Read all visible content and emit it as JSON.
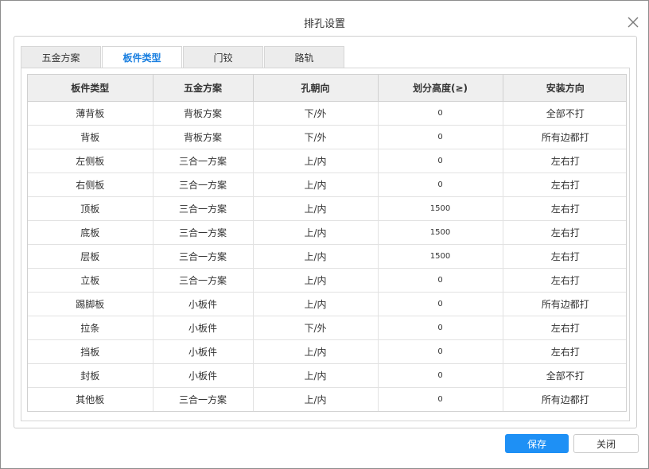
{
  "dialog": {
    "title": "排孔设置",
    "close_icon": "close-icon"
  },
  "tabs": [
    {
      "label": "五金方案",
      "active": false
    },
    {
      "label": "板件类型",
      "active": true
    },
    {
      "label": "门铰",
      "active": false
    },
    {
      "label": "路轨",
      "active": false
    }
  ],
  "table": {
    "headers": [
      "板件类型",
      "五金方案",
      "孔朝向",
      "划分高度(≥)",
      "安装方向"
    ],
    "rows": [
      [
        "薄背板",
        "背板方案",
        "下/外",
        "0",
        "全部不打"
      ],
      [
        "背板",
        "背板方案",
        "下/外",
        "0",
        "所有边都打"
      ],
      [
        "左侧板",
        "三合一方案",
        "上/内",
        "0",
        "左右打"
      ],
      [
        "右侧板",
        "三合一方案",
        "上/内",
        "0",
        "左右打"
      ],
      [
        "顶板",
        "三合一方案",
        "上/内",
        "1500",
        "左右打"
      ],
      [
        "底板",
        "三合一方案",
        "上/内",
        "1500",
        "左右打"
      ],
      [
        "层板",
        "三合一方案",
        "上/内",
        "1500",
        "左右打"
      ],
      [
        "立板",
        "三合一方案",
        "上/内",
        "0",
        "左右打"
      ],
      [
        "踢脚板",
        "小板件",
        "上/内",
        "0",
        "所有边都打"
      ],
      [
        "拉条",
        "小板件",
        "下/外",
        "0",
        "左右打"
      ],
      [
        "挡板",
        "小板件",
        "上/内",
        "0",
        "左右打"
      ],
      [
        "封板",
        "小板件",
        "上/内",
        "0",
        "全部不打"
      ],
      [
        "其他板",
        "三合一方案",
        "上/内",
        "0",
        "所有边都打"
      ]
    ]
  },
  "footer": {
    "save_label": "保存",
    "close_label": "关闭"
  },
  "colors": {
    "accent": "#1e90f5",
    "active_tab_text": "#1a7fe0"
  }
}
